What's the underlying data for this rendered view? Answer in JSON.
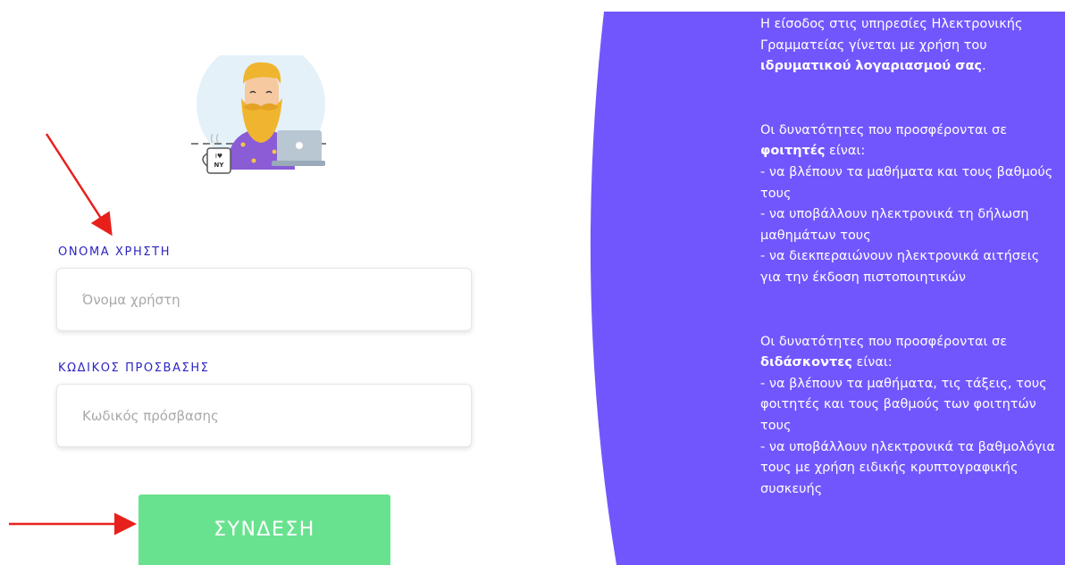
{
  "login": {
    "username_label": "ΟΝΟΜΑ ΧΡΗΣΤΗ",
    "username_placeholder": "Όνομα χρήστη",
    "password_label": "ΚΩΔΙΚΟΣ ΠΡΟΣΒΑΣΗΣ",
    "password_placeholder": "Κωδικός πρόσβασης",
    "submit_label": "ΣΥΝΔΕΣΗ"
  },
  "illustration": {
    "mug_text_top": "I♥",
    "mug_text_bottom": "NY"
  },
  "info": {
    "intro_line": "Η είσοδος στις υπηρεσίες Ηλεκτρονικής Γραμματείας γίνεται με χρήση του ",
    "intro_bold": "ιδρυματικού λογαριασμού σας",
    "intro_end": ".",
    "students_pre": "Οι δυνατότητες που προσφέρονται σε ",
    "students_bold": "φοιτητές",
    "students_post": " είναι:",
    "students_items": [
      "- να βλέπουν τα μαθήματα και τους βαθμούς τους",
      "- να υποβάλλουν ηλεκτρονικά τη δήλωση μαθημάτων τους",
      "- να διεκπεραιώνουν ηλεκτρονικά αιτήσεις για την έκδοση πιστοποιητικών"
    ],
    "teachers_pre": "Οι δυνατότητες που προσφέρονται σε ",
    "teachers_bold": "διδάσκοντες",
    "teachers_post": " είναι:",
    "teachers_items": [
      "- να βλέπουν τα μαθήματα, τις τάξεις, τους φοιτητές και τους βαθμούς των φοιτητών τους",
      "- να υποβάλλουν ηλεκτρονικά τα βαθμολόγια τους με χρήση ειδικής κρυπτογραφικής συσκευής"
    ]
  },
  "colors": {
    "accent_purple": "#7256fd",
    "label_blue": "#2d25c2",
    "button_green": "#69e28f",
    "annotation_red": "#e8201c"
  }
}
